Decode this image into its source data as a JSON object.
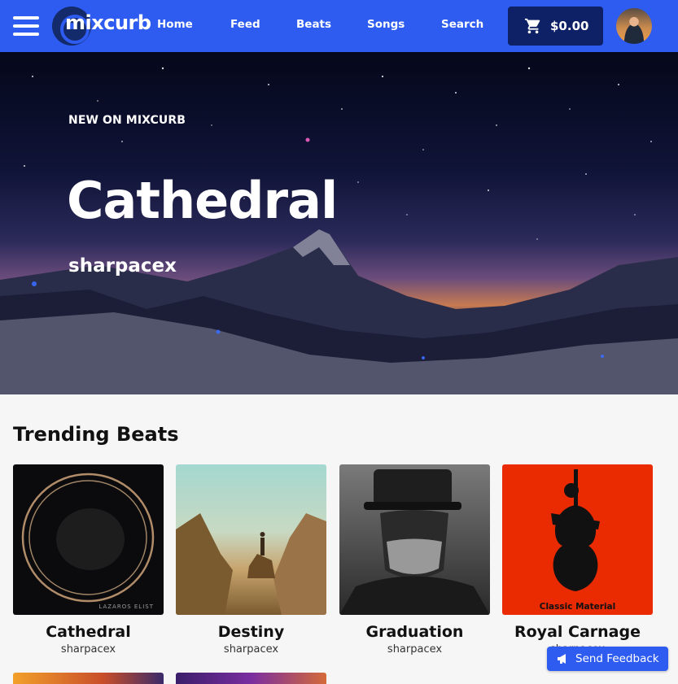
{
  "app": {
    "logo_text": "mixcurb",
    "brand_color": "#2e5cf0",
    "cart_color": "#0f2166"
  },
  "nav": {
    "links": [
      "Home",
      "Feed",
      "Beats",
      "Songs",
      "Search"
    ],
    "cart_total": "$0.00",
    "icons": {
      "menu": "hamburger-menu-icon",
      "cart": "shopping-cart-icon"
    }
  },
  "hero": {
    "kicker": "NEW ON MIXCURB",
    "title": "Cathedral",
    "artist": "sharpacex"
  },
  "trending": {
    "heading": "Trending Beats",
    "items": [
      {
        "title": "Cathedral",
        "artist": "sharpacex",
        "cover_text": "LAZAROS ELIST"
      },
      {
        "title": "Destiny",
        "artist": "sharpacex"
      },
      {
        "title": "Graduation",
        "artist": "sharpacex"
      },
      {
        "title": "Royal Carnage",
        "artist": "sharpacex",
        "cover_text": "Classic Material"
      }
    ]
  },
  "feedback": {
    "label": "Send Feedback",
    "icon": "megaphone-icon"
  }
}
